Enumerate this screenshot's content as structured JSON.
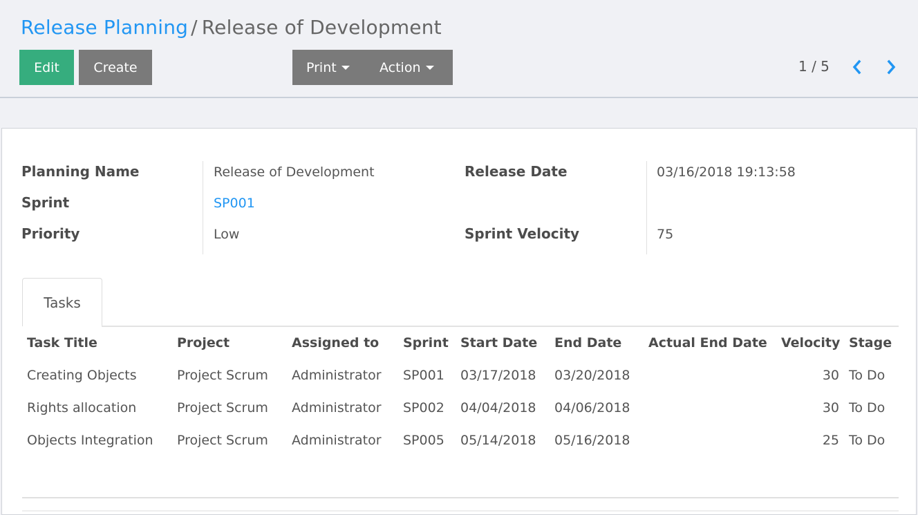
{
  "breadcrumb": {
    "parent": "Release Planning",
    "separator": "/",
    "current": "Release of Development"
  },
  "toolbar": {
    "edit_label": "Edit",
    "create_label": "Create",
    "print_label": "Print",
    "action_label": "Action"
  },
  "pager": {
    "value": "1 / 5",
    "prev_icon": "chevron-left-icon",
    "next_icon": "chevron-right-icon"
  },
  "colors": {
    "accent": "#2196f3",
    "primary_button": "#36ad7e",
    "secondary_button": "#7a7a7a"
  },
  "form": {
    "left": [
      {
        "label": "Planning Name",
        "value": "Release of Development",
        "link": false
      },
      {
        "label": "Sprint",
        "value": "SP001",
        "link": true
      },
      {
        "label": "Priority",
        "value": "Low",
        "link": false
      }
    ],
    "right": [
      {
        "label": "Release Date",
        "value": "03/16/2018 19:13:58"
      },
      {
        "label": "Sprint Velocity",
        "value": "75"
      }
    ]
  },
  "tabs": [
    {
      "label": "Tasks",
      "active": true
    }
  ],
  "tasks": {
    "columns": [
      "Task Title",
      "Project",
      "Assigned to",
      "Sprint",
      "Start Date",
      "End Date",
      "Actual End Date",
      "Velocity",
      "Stage"
    ],
    "rows": [
      [
        "Creating Objects",
        "Project Scrum",
        "Administrator",
        "SP001",
        "03/17/2018",
        "03/20/2018",
        "",
        "30",
        "To Do"
      ],
      [
        "Rights allocation",
        "Project Scrum",
        "Administrator",
        "SP002",
        "04/04/2018",
        "04/06/2018",
        "",
        "30",
        "To Do"
      ],
      [
        "Objects Integration",
        "Project Scrum",
        "Administrator",
        "SP005",
        "05/14/2018",
        "05/16/2018",
        "",
        "25",
        "To Do"
      ]
    ]
  }
}
